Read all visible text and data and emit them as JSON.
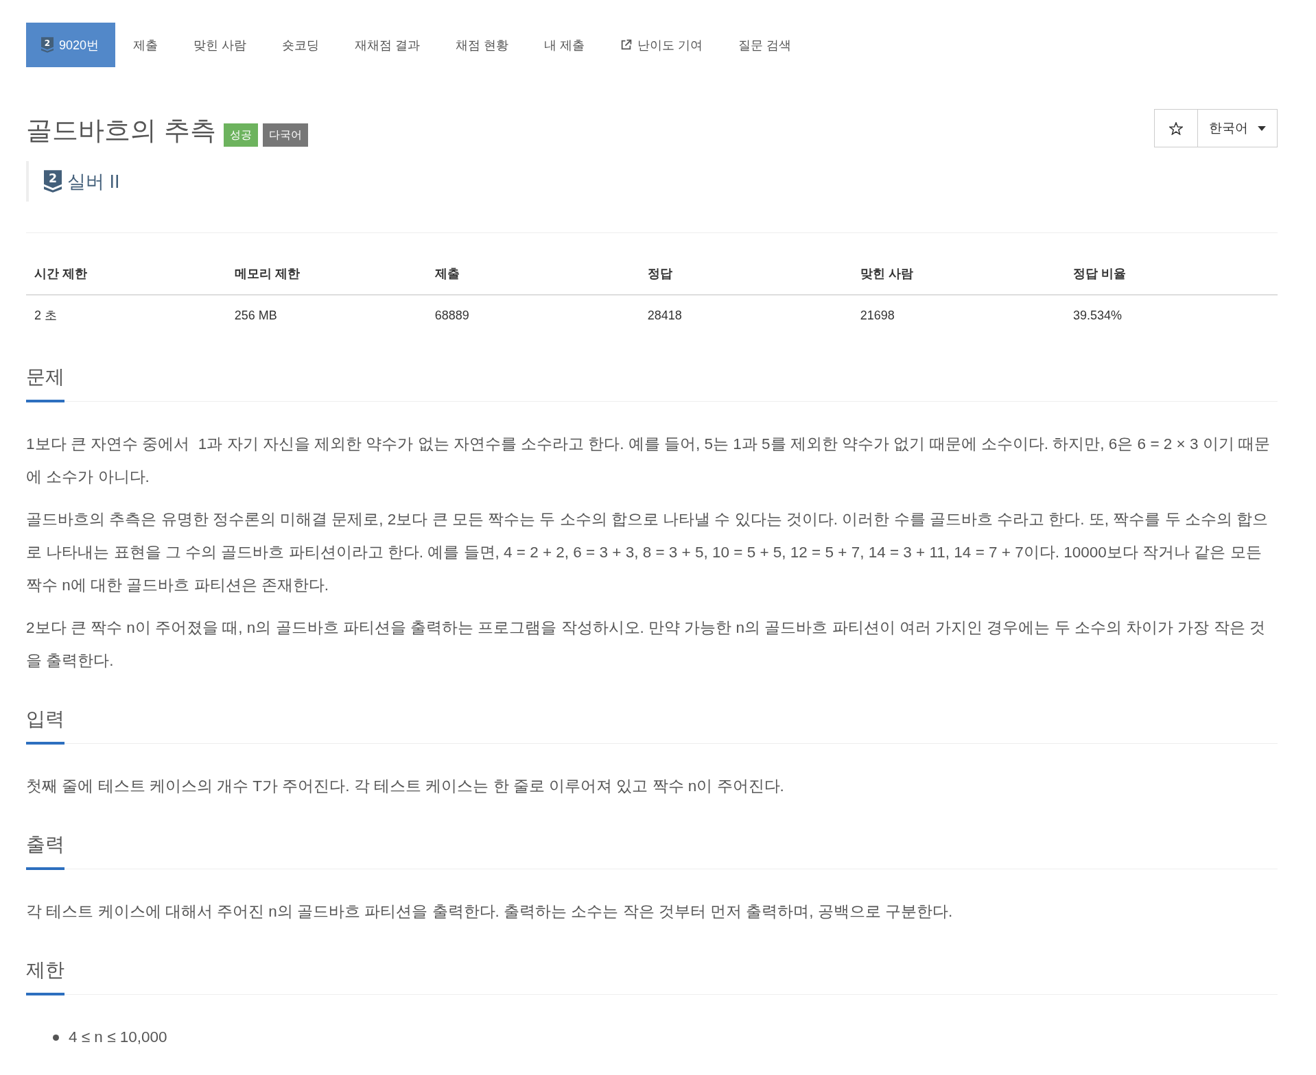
{
  "nav": {
    "tabs": [
      {
        "kind": "problem",
        "tier_number": "2",
        "label": "9020번",
        "selected": true
      },
      {
        "kind": "link",
        "label": "제출",
        "selected": false
      },
      {
        "kind": "link",
        "label": "맞힌 사람",
        "selected": false
      },
      {
        "kind": "link",
        "label": "숏코딩",
        "selected": false
      },
      {
        "kind": "link",
        "label": "재채점 결과",
        "selected": false
      },
      {
        "kind": "link",
        "label": "채점 현황",
        "selected": false
      },
      {
        "kind": "link",
        "label": "내 제출",
        "selected": false
      },
      {
        "kind": "external",
        "label": "난이도 기여",
        "selected": false
      },
      {
        "kind": "link",
        "label": "질문 검색",
        "selected": false
      }
    ]
  },
  "problem": {
    "title": "골드바흐의 추측",
    "badges": [
      {
        "label": "성공",
        "color": "#6db35e"
      },
      {
        "label": "다국어",
        "color": "#777777"
      }
    ],
    "tier": {
      "number": "2",
      "label": "실버 II"
    },
    "favorite": {
      "starred": false
    },
    "language": {
      "value": "한국어"
    }
  },
  "stats": {
    "columns": [
      "시간 제한",
      "메모리 제한",
      "제출",
      "정답",
      "맞힌 사람",
      "정답 비율"
    ],
    "rows": [
      [
        "2 초",
        "256 MB",
        "68889",
        "28418",
        "21698",
        "39.534%"
      ]
    ]
  },
  "sections": [
    {
      "kind": "text",
      "title": "문제",
      "paragraphs": [
        "1보다 큰 자연수 중에서  1과 자기 자신을 제외한 약수가 없는 자연수를 소수라고 한다. 예를 들어, 5는 1과 5를 제외한 약수가 없기 때문에 소수이다. 하지만, 6은 6 = 2 × 3 이기 때문에 소수가 아니다.",
        "골드바흐의 추측은 유명한 정수론의 미해결 문제로, 2보다 큰 모든 짝수는 두 소수의 합으로 나타낼 수 있다는 것이다. 이러한 수를 골드바흐 수라고 한다. 또, 짝수를 두 소수의 합으로 나타내는 표현을 그 수의 골드바흐 파티션이라고 한다. 예를 들면, 4 = 2 + 2, 6 = 3 + 3, 8 = 3 + 5, 10 = 5 + 5, 12 = 5 + 7, 14 = 3 + 11, 14 = 7 + 7이다. 10000보다 작거나 같은 모든 짝수 n에 대한 골드바흐 파티션은 존재한다.",
        "2보다 큰 짝수 n이 주어졌을 때, n의 골드바흐 파티션을 출력하는 프로그램을 작성하시오. 만약 가능한 n의 골드바흐 파티션이 여러 가지인 경우에는 두 소수의 차이가 가장 작은 것을 출력한다."
      ]
    },
    {
      "kind": "text",
      "title": "입력",
      "paragraphs": [
        "첫째 줄에 테스트 케이스의 개수 T가 주어진다. 각 테스트 케이스는 한 줄로 이루어져 있고 짝수 n이 주어진다."
      ]
    },
    {
      "kind": "text",
      "title": "출력",
      "paragraphs": [
        "각 테스트 케이스에 대해서 주어진 n의 골드바흐 파티션을 출력한다. 출력하는 소수는 작은 것부터 먼저 출력하며, 공백으로 구분한다."
      ]
    },
    {
      "kind": "list",
      "title": "제한",
      "items": [
        "4 ≤ n ≤ 10,000"
      ]
    }
  ]
}
